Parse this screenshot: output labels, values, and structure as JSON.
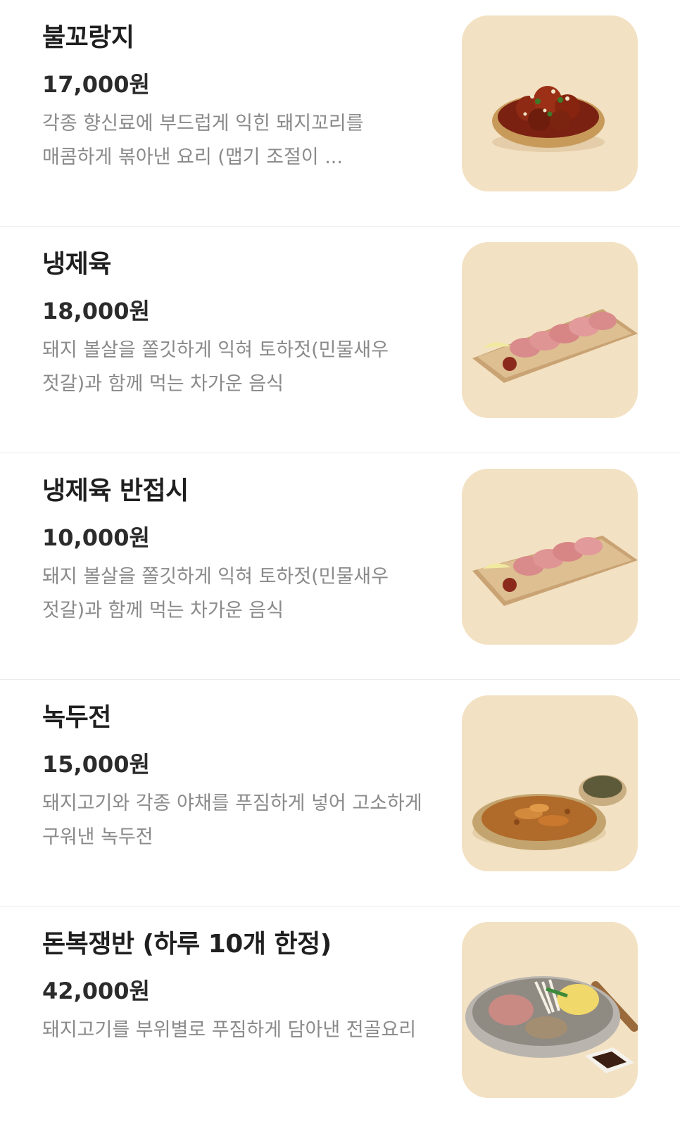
{
  "menu": {
    "items": [
      {
        "name": "불꼬랑지",
        "price": "17,000원",
        "description": "각종 향신료에 부드럽게 익힌 돼지꼬리를 매콤하게 볶아낸 요리 (맵기 조절이 ...",
        "image_icon": "braised-pork-tail-dish-icon"
      },
      {
        "name": "냉제육",
        "price": "18,000원",
        "description": "돼지 볼살을 쫄깃하게 익혀 토하젓(민물새우 젓갈)과 함께 먹는 차가운 음식",
        "image_icon": "cold-sliced-pork-platter-icon"
      },
      {
        "name": "냉제육 반접시",
        "price": "10,000원",
        "description": "돼지 볼살을 쫄깃하게 익혀 토하젓(민물새우 젓갈)과 함께 먹는 차가운 음식",
        "image_icon": "cold-sliced-pork-half-platter-icon"
      },
      {
        "name": "녹두전",
        "price": "15,000원",
        "description": "돼지고기와 각종 야채를 푸짐하게 넣어 고소하게 구워낸 녹두전",
        "image_icon": "mung-bean-pancake-icon"
      },
      {
        "name": "돈복쟁반 (하루 10개 한정)",
        "price": "42,000원",
        "description": "돼지고기를 부위별로 푸짐하게 담아낸 전골요리",
        "image_icon": "pork-hotpot-tray-icon"
      }
    ]
  },
  "colors": {
    "image_background": "#f3e1c3",
    "description_text": "#8a8a8a",
    "divider": "#ececec"
  }
}
